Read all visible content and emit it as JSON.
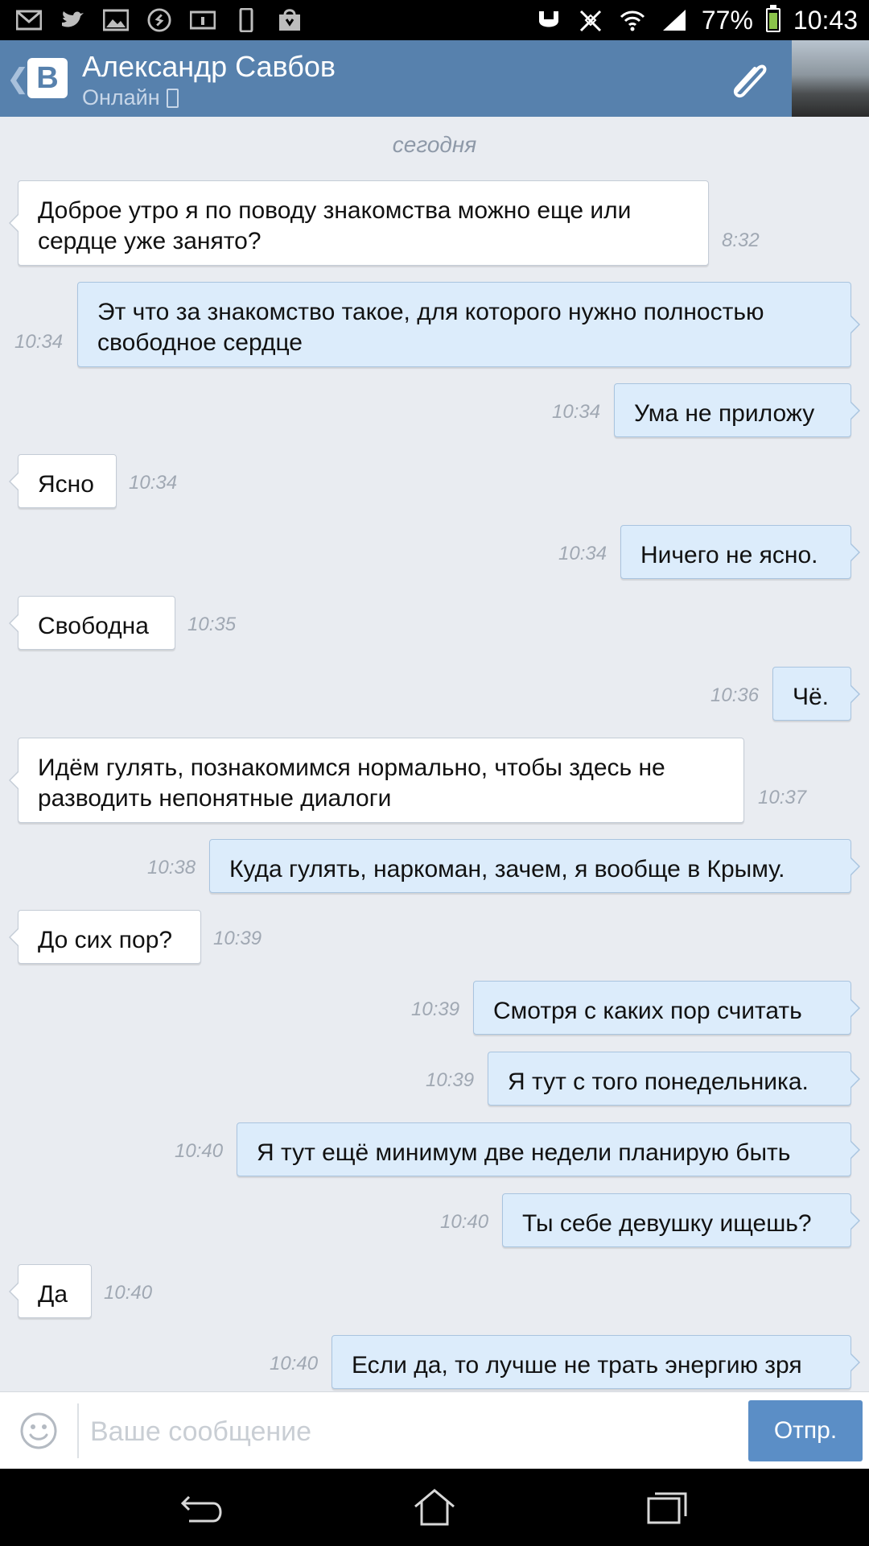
{
  "status_bar": {
    "battery_percent": "77%",
    "battery_level": 0.77,
    "time": "10:43",
    "left_icons": [
      "gmail-icon",
      "twitter-icon",
      "gallery-icon",
      "shazam-icon",
      "info-card-icon",
      "phone-icon",
      "store-icon"
    ],
    "right_icons": [
      "sync-icon",
      "vibrate-off-icon",
      "wifi-icon",
      "signal-icon"
    ]
  },
  "header": {
    "back_icon": "chevron-left-icon",
    "logo_text": "В",
    "contact_name": "Александр Савбов",
    "contact_status": "Онлайн",
    "attach_icon": "paperclip-icon"
  },
  "conversation": {
    "date_separator": "сегодня",
    "messages": [
      {
        "direction": "in",
        "text": "Доброе утро я по поводу знакомства можно еще или сердце уже занято?",
        "time": "8:32"
      },
      {
        "direction": "out",
        "text": "Эт что за знакомство такое, для которого нужно полностью свободное сердце",
        "time": "10:34"
      },
      {
        "direction": "out",
        "text": "Ума не приложу",
        "time": "10:34"
      },
      {
        "direction": "in",
        "text": "Ясно",
        "time": "10:34"
      },
      {
        "direction": "out",
        "text": "Ничего не ясно.",
        "time": "10:34"
      },
      {
        "direction": "in",
        "text": "Свободна",
        "time": "10:35"
      },
      {
        "direction": "out",
        "text": "Чё.",
        "time": "10:36"
      },
      {
        "direction": "in",
        "text": "Идём гулять, познакомимся нормально, чтобы здесь не разводить непонятные диалоги",
        "time": "10:37"
      },
      {
        "direction": "out",
        "text": "Куда гулять, наркоман, зачем, я вообще в Крыму.",
        "time": "10:38"
      },
      {
        "direction": "in",
        "text": "До сих пор?",
        "time": "10:39"
      },
      {
        "direction": "out",
        "text": "Смотря с каких пор считать",
        "time": "10:39"
      },
      {
        "direction": "out",
        "text": "Я тут с того понедельника.",
        "time": "10:39"
      },
      {
        "direction": "out",
        "text": "Я тут ещё минимум две недели планирую быть",
        "time": "10:40"
      },
      {
        "direction": "out",
        "text": "Ты себе девушку ищешь?",
        "time": "10:40"
      },
      {
        "direction": "in",
        "text": "Да",
        "time": "10:40"
      },
      {
        "direction": "out",
        "text": "Если да, то лучше не трать энергию зря",
        "time": "10:40"
      }
    ]
  },
  "composer": {
    "emoji_icon": "smiley-icon",
    "placeholder": "Ваше сообщение",
    "value": "",
    "send_label": "Отпр."
  },
  "nav_bar": {
    "icons": [
      "back-icon",
      "home-icon",
      "recents-icon"
    ]
  },
  "colors": {
    "header": "#5781ad",
    "background": "#e9ecf1",
    "incoming_bubble": "#ffffff",
    "outgoing_bubble": "#dcecfb",
    "send_button": "#5b8ec6"
  }
}
